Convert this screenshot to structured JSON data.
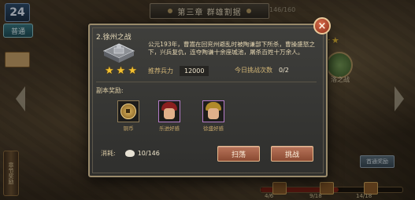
{
  "hud": {
    "level": "24",
    "mode_tab": "普通",
    "chapter_title": "第三章  群雄割据",
    "chapter_progress": "146/160",
    "side_scroll_label": "章节奖励",
    "right_badge": "首通奖励",
    "right_node_label": "洛之战",
    "bottom_labels": [
      "4/6",
      "9/18",
      "14/18"
    ],
    "bottom_progress_fraction": 0.55
  },
  "dialog": {
    "stage_title": "2.徐州之战",
    "stage_stars": 3,
    "description": "公元193年，曹嵩在回兖州避乱时被陶谦部下所杀，曹操盛怒之下，兴兵复仇，连夺陶谦十余座城池，屠杀百姓十万余人。",
    "recommended_label": "推荐兵力",
    "recommended_value": "12000",
    "today_label": "今日挑战次数",
    "today_value": "0/2",
    "rewards_label": "副本奖励:",
    "rewards": [
      {
        "icon": "copper-coin-icon",
        "name": "铜币"
      },
      {
        "icon": "hero-portrait-icon",
        "name": "乐进好感"
      },
      {
        "icon": "hero-portrait-icon",
        "name": "徐盛好感"
      }
    ],
    "cost_label": "消耗:",
    "cost_value": "10/146",
    "sweep_label": "扫荡",
    "battle_label": "挑战",
    "close_glyph": "×"
  },
  "colors": {
    "accent_gold": "#f3c030",
    "button": "#a45d43",
    "panel": "#383836"
  }
}
